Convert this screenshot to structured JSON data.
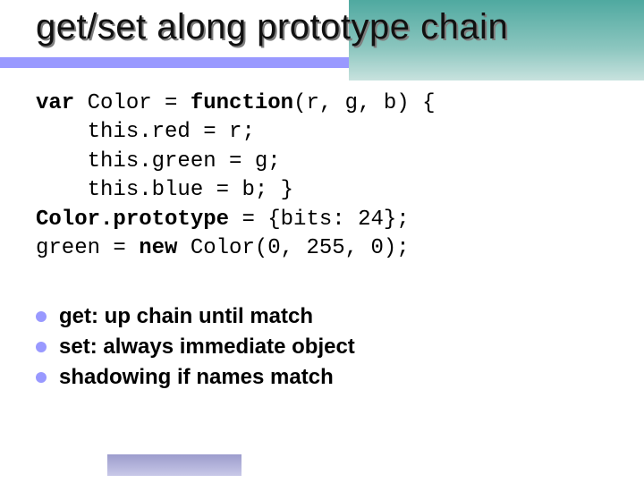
{
  "title": "get/set along prototype chain",
  "code": {
    "l1a": "var",
    "l1b": " Color = ",
    "l1c": "function",
    "l1d": "(r, g, b) {",
    "l2": "    this.red = r;",
    "l3": "    this.green = g;",
    "l4": "    this.blue = b; }",
    "l5a": "Color.prototype",
    "l5b": " = {bits: 24};",
    "l6a": "green = ",
    "l6b": "new",
    "l6c": " Color(0, 255, 0);"
  },
  "bullets": [
    {
      "bold": "get: up chain until match",
      "rest": ""
    },
    {
      "bold": "set: always immediate object",
      "rest": ""
    },
    {
      "bold": "shadowing if names match",
      "rest": ""
    }
  ]
}
